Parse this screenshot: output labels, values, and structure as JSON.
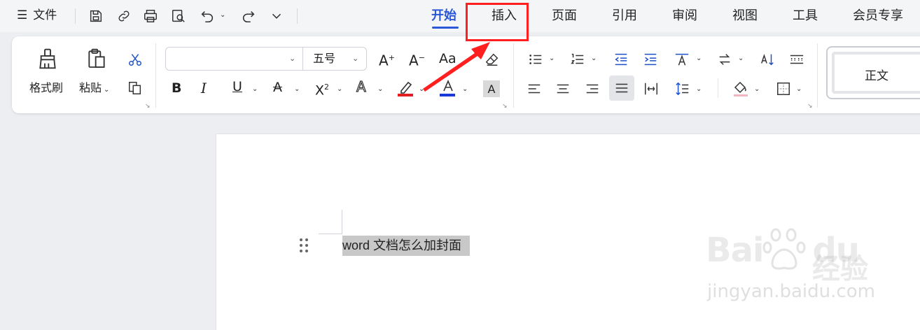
{
  "topbar": {
    "file_menu": "文件",
    "tabs": [
      "开始",
      "插入",
      "页面",
      "引用",
      "审阅",
      "视图",
      "工具",
      "会员专享"
    ],
    "active_tab": "开始"
  },
  "ribbon": {
    "format_painter": "格式刷",
    "paste": "粘贴",
    "font_name": "",
    "font_size": "五号",
    "style_normal": "正文"
  },
  "document": {
    "text": "word 文档怎么加封面"
  },
  "watermark": {
    "logo": "Bai",
    "logo_suffix": "du",
    "cn": "经验",
    "url": "jingyan.baidu.com"
  },
  "colors": {
    "accent": "#2a57d8",
    "annotation": "#ff1f1f",
    "font_color_red": "#e02020",
    "font_color_blue": "#1a3ad8"
  }
}
